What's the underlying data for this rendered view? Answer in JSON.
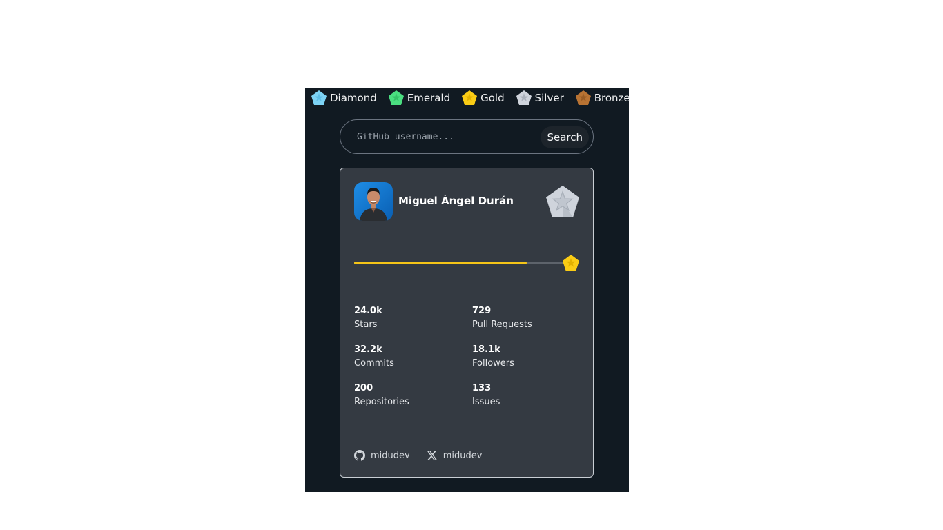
{
  "legend": [
    {
      "label": "Diamond",
      "color": "#7dd3f5",
      "icon": "diamond-gem-icon"
    },
    {
      "label": "Emerald",
      "color": "#4ade80",
      "icon": "emerald-gem-icon"
    },
    {
      "label": "Gold",
      "color": "#facc15",
      "icon": "gold-gem-icon"
    },
    {
      "label": "Silver",
      "color": "#cfd4dc",
      "icon": "silver-gem-icon"
    },
    {
      "label": "Bronze",
      "color": "#b87333",
      "icon": "bronze-gem-icon"
    }
  ],
  "search": {
    "placeholder": "GitHub username...",
    "value": "",
    "button_label": "Search"
  },
  "profile": {
    "name": "Miguel Ángel Durán",
    "avatar_icon": "user-avatar",
    "current_rank": "Silver",
    "next_rank": "Gold",
    "progress_percent": 82
  },
  "stats": [
    {
      "value": "24.0k",
      "label": "Stars"
    },
    {
      "value": "729",
      "label": "Pull Requests"
    },
    {
      "value": "32.2k",
      "label": "Commits"
    },
    {
      "value": "18.1k",
      "label": "Followers"
    },
    {
      "value": "200",
      "label": "Repositories"
    },
    {
      "value": "133",
      "label": "Issues"
    }
  ],
  "socials": {
    "github": {
      "icon": "github-icon",
      "handle": "midudev"
    },
    "x": {
      "icon": "x-icon",
      "handle": "midudev"
    }
  },
  "colors": {
    "page_bg": "#111a22",
    "card_bg": "#343a42",
    "progress_fill": "#f5c518",
    "progress_track": "#5d636b"
  }
}
